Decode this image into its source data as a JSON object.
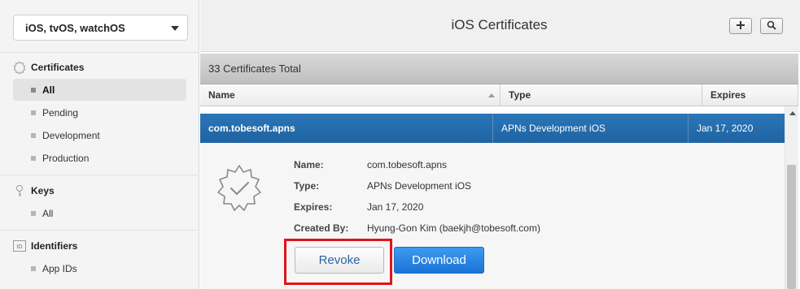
{
  "sidebar": {
    "platform_select": "iOS, tvOS, watchOS",
    "certificates": {
      "heading": "Certificates",
      "items": [
        "All",
        "Pending",
        "Development",
        "Production"
      ],
      "active": "All"
    },
    "keys": {
      "heading": "Keys",
      "items": [
        "All"
      ]
    },
    "identifiers": {
      "heading": "Identifiers",
      "items": [
        "App IDs"
      ]
    }
  },
  "header": {
    "title": "iOS Certificates",
    "add_icon": "plus-icon",
    "search_icon": "search-icon"
  },
  "table": {
    "summary": "33 Certificates Total",
    "columns": [
      "Name",
      "Type",
      "Expires"
    ],
    "selected_row": {
      "name": "com.tobesoft.apns",
      "type": "APNs Development iOS",
      "expires": "Jan 17, 2020"
    }
  },
  "detail": {
    "fields": [
      {
        "label": "Name:",
        "value": "com.tobesoft.apns"
      },
      {
        "label": "Type:",
        "value": "APNs Development iOS"
      },
      {
        "label": "Expires:",
        "value": "Jan 17, 2020"
      },
      {
        "label": "Created By:",
        "value": "Hyung-Gon Kim (baekjh@tobesoft.com)"
      }
    ],
    "revoke_label": "Revoke",
    "download_label": "Download"
  },
  "colors": {
    "selected_row": "#2068a9",
    "download_button": "#2a86e3",
    "highlight_box": "#e0141a"
  }
}
